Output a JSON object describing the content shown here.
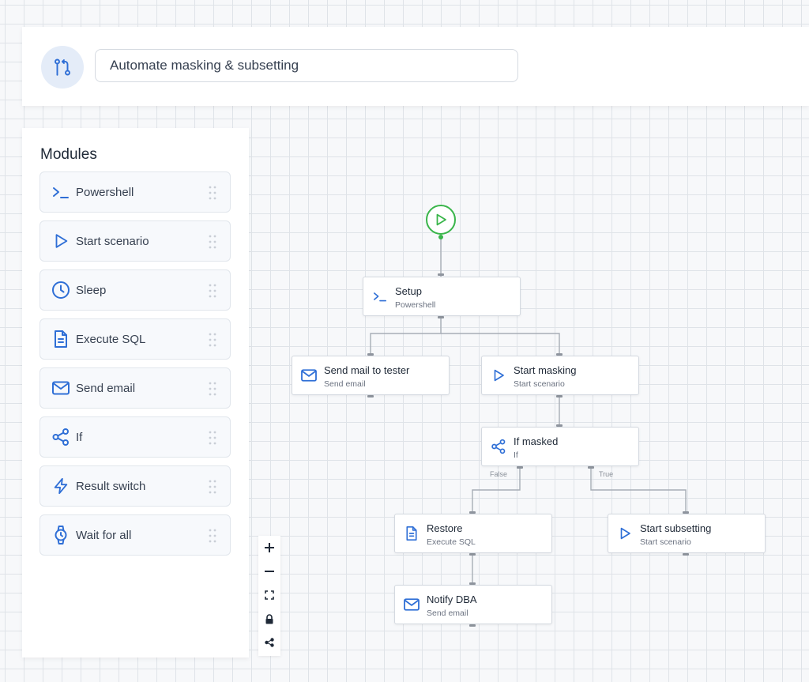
{
  "header": {
    "workflow_name": "Automate masking & subsetting",
    "icon": "git-branch-icon"
  },
  "modules": {
    "title": "Modules",
    "items": [
      {
        "label": "Powershell",
        "icon": "terminal-icon"
      },
      {
        "label": "Start scenario",
        "icon": "play-icon"
      },
      {
        "label": "Sleep",
        "icon": "clock-icon"
      },
      {
        "label": "Execute SQL",
        "icon": "document-icon"
      },
      {
        "label": "Send email",
        "icon": "mail-icon"
      },
      {
        "label": "If",
        "icon": "share-icon"
      },
      {
        "label": "Result switch",
        "icon": "lightning-icon"
      },
      {
        "label": "Wait for all",
        "icon": "watch-icon"
      }
    ]
  },
  "zoom_controls": [
    "zoom-in",
    "zoom-out",
    "fit-view",
    "lock",
    "share"
  ],
  "flow": {
    "start": {
      "icon": "play-icon",
      "color": "#39b54a"
    },
    "nodes": {
      "setup": {
        "title": "Setup",
        "subtitle": "Powershell",
        "icon": "terminal-icon"
      },
      "send_mail": {
        "title": "Send mail to tester",
        "subtitle": "Send email",
        "icon": "mail-icon"
      },
      "start_masking": {
        "title": "Start masking",
        "subtitle": "Start scenario",
        "icon": "play-icon"
      },
      "if_masked": {
        "title": "If masked",
        "subtitle": "If",
        "icon": "share-icon"
      },
      "restore": {
        "title": "Restore",
        "subtitle": "Execute SQL",
        "icon": "document-icon"
      },
      "start_subsetting": {
        "title": "Start subsetting",
        "subtitle": "Start scenario",
        "icon": "play-icon"
      },
      "notify_dba": {
        "title": "Notify DBA",
        "subtitle": "Send email",
        "icon": "mail-icon"
      }
    },
    "edge_labels": {
      "false_label": "False",
      "true_label": "True"
    }
  },
  "colors": {
    "accent": "#2f6fd6",
    "start": "#39b54a",
    "icon_bg": "#e4ecf8"
  }
}
